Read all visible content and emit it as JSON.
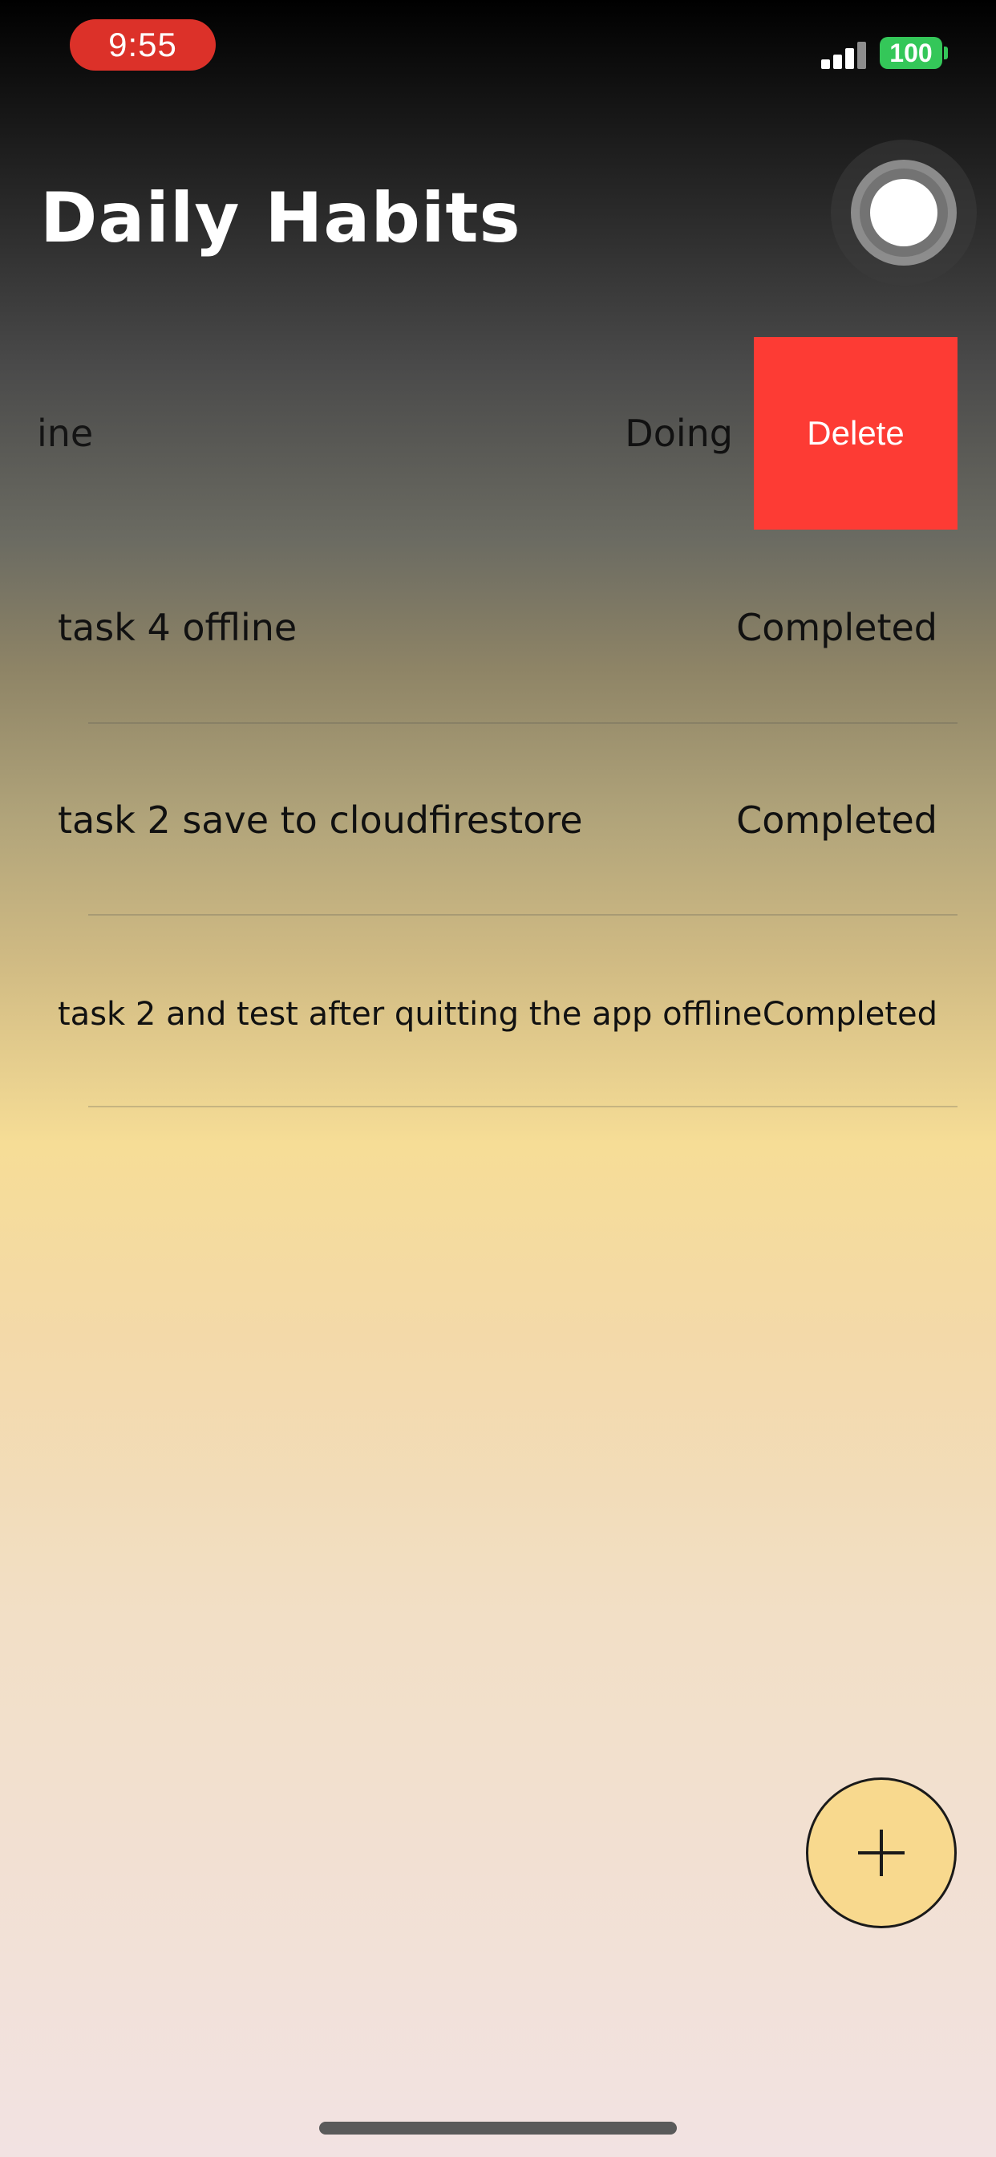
{
  "status_bar": {
    "time": "9:55",
    "battery": "100",
    "colors": {
      "time_pill": "#dc3129",
      "battery": "#34c759"
    }
  },
  "header": {
    "title": "Daily Habits"
  },
  "habits": [
    {
      "name": "ine",
      "status": "Doing"
    },
    {
      "name": "task 4 offline",
      "status": "Completed"
    },
    {
      "name": "task 2 save to cloudfirestore",
      "status": "Completed"
    },
    {
      "name": "task 2 and test after quitting the app offline",
      "status": "Completed"
    }
  ],
  "swipe_action": {
    "label": "Delete",
    "color": "#fd3b34"
  },
  "fab": {
    "icon": "plus-icon",
    "color": "#f8d98e"
  }
}
